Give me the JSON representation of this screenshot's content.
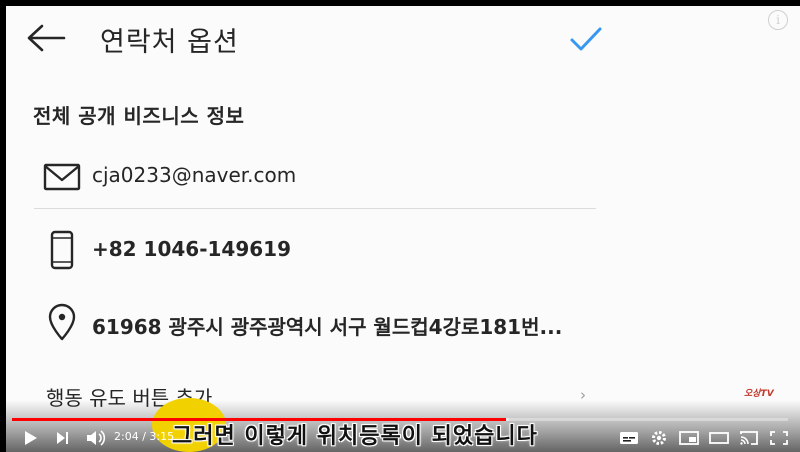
{
  "app": {
    "title": "연락처 옵션",
    "section_title": "전체 공개 비즈니스 정보",
    "email": "cja0233@naver.com",
    "phone": "+82 1046-149619",
    "address": "61968 광주시 광주광역시 서구 월드컵4강로181번...",
    "action_label": "행동 유도 버튼 추가",
    "action_chevron": "›",
    "icons": [
      "back-arrow-icon",
      "checkmark-icon",
      "mail-icon",
      "phone-icon",
      "location-pin-icon",
      "chevron-right-icon"
    ],
    "accent_color": "#3897f0"
  },
  "video": {
    "subtitle": "그러면 이렇게 위치등록이 되었습니다",
    "watermark": "오상TV",
    "info_label": "i",
    "current_time": "2:04",
    "duration": "3:15",
    "time_separator": " / ",
    "progress_fraction": 0.636,
    "buffer_fraction": 0.64,
    "progress_color": "#ff0000",
    "icons": [
      "play-icon",
      "next-icon",
      "volume-icon",
      "subtitles-icon",
      "settings-icon",
      "miniplayer-icon",
      "theater-icon",
      "cast-icon",
      "fullscreen-icon"
    ]
  }
}
